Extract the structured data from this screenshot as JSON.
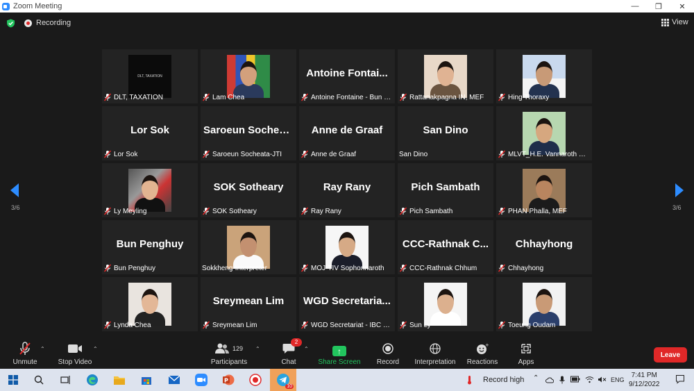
{
  "window": {
    "title": "Zoom Meeting",
    "controls": [
      "—",
      "❐",
      "✕"
    ]
  },
  "topbar": {
    "recording_label": "Recording",
    "view_label": "View"
  },
  "navigation": {
    "page_left": "3/6",
    "page_right": "3/6"
  },
  "tiles": [
    {
      "label": "DLT, TAXATION",
      "photo": "ph-dlt",
      "photo_text": "DLT, TAXATION"
    },
    {
      "label": "Lam Chea",
      "photo": "ph-lam"
    },
    {
      "label": "Antoine Fontaine - Bun &...",
      "display": "Antoine Fontai..."
    },
    {
      "label": "Rattanakpagna IN, MEF",
      "photo": "ph-ratt"
    },
    {
      "label": "Hing Thoraxy",
      "photo": "ph-hing"
    },
    {
      "label": "Lor Sok",
      "display": "Lor Sok"
    },
    {
      "label": "Saroeun Socheata-JTI",
      "display": "Saroeun Sochea..."
    },
    {
      "label": "Anne de Graaf",
      "display": "Anne de Graaf"
    },
    {
      "label": "San Dino",
      "display": "San Dino",
      "no_mic": true
    },
    {
      "label": "MLVT_H.E. Vannaroth Sov...",
      "photo": "ph-mlvt"
    },
    {
      "label": "Ly Meyling",
      "photo": "ph-ly"
    },
    {
      "label": "SOK Sotheary",
      "display": "SOK Sotheary"
    },
    {
      "label": "Ray Rany",
      "display": "Ray Rany"
    },
    {
      "label": "Pich Sambath",
      "display": "Pich Sambath"
    },
    {
      "label": "PHAN Phalla, MEF",
      "photo": "ph-phan"
    },
    {
      "label": "Bun Penghuy",
      "display": "Bun Penghuy"
    },
    {
      "label": "Sokkheng-Interpreter",
      "photo": "ph-sokk",
      "no_mic": true
    },
    {
      "label": "MOJ-TIV Sophonnaroth",
      "photo": "ph-moj"
    },
    {
      "label": "CCC-Rathnak Chhum",
      "display": "CCC-Rathnak C..."
    },
    {
      "label": "Chhayhong",
      "display": "Chhayhong"
    },
    {
      "label": "Lynda Chea",
      "photo": "ph-lynda"
    },
    {
      "label": "Sreymean Lim",
      "display": "Sreymean Lim"
    },
    {
      "label": "WGD Secretariat - IBC - C...",
      "display": "WGD Secretaria..."
    },
    {
      "label": "Sun Ly",
      "photo": "ph-sun"
    },
    {
      "label": "Toeung Oudam",
      "photo": "ph-toeung"
    }
  ],
  "toolbar": {
    "unmute": "Unmute",
    "stop_video": "Stop Video",
    "participants": "Participants",
    "participants_count": "129",
    "chat": "Chat",
    "chat_badge": "2",
    "share_screen": "Share Screen",
    "record": "Record",
    "interpretation": "Interpretation",
    "reactions": "Reactions",
    "apps": "Apps",
    "leave": "Leave"
  },
  "taskbar": {
    "record_status": "Record high",
    "language": "ENG",
    "time": "7:41 PM",
    "date": "9/12/2022",
    "telegram_badge": "10"
  },
  "colors": {
    "accent": "#2d8cff",
    "share": "#22c55e",
    "leave": "#e02828",
    "mute": "#e02828"
  }
}
